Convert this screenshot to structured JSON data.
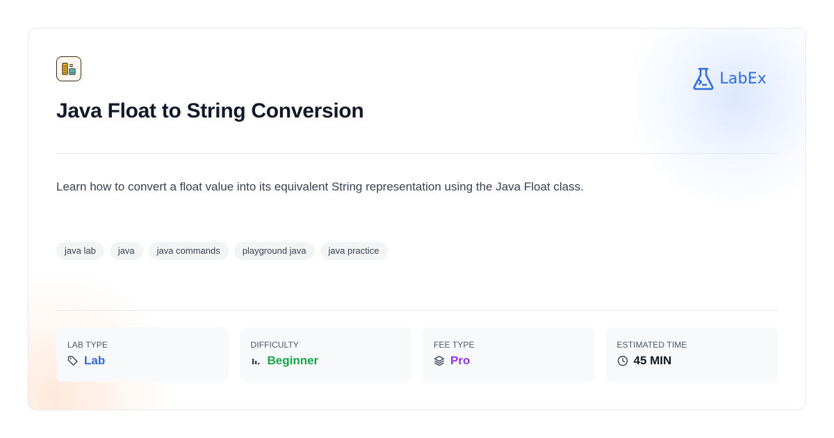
{
  "brand": {
    "name": "LabEx",
    "color": "#2e6bde"
  },
  "lab": {
    "icon": "code-file-icon",
    "title": "Java Float to String Conversion",
    "description": "Learn how to convert a float value into its equivalent String representation using the Java Float class."
  },
  "tags": [
    "java lab",
    "java",
    "java commands",
    "playground java",
    "java practice"
  ],
  "stats": [
    {
      "label": "LAB TYPE",
      "value": "Lab",
      "icon": "tag-icon",
      "color": "#2e6bde"
    },
    {
      "label": "DIFFICULTY",
      "value": "Beginner",
      "icon": "bar-level-icon",
      "color": "#16a34a"
    },
    {
      "label": "FEE TYPE",
      "value": "Pro",
      "icon": "layers-icon",
      "color": "#9333ea"
    },
    {
      "label": "ESTIMATED TIME",
      "value": "45 MIN",
      "icon": "clock-icon",
      "color": "#111827"
    }
  ]
}
